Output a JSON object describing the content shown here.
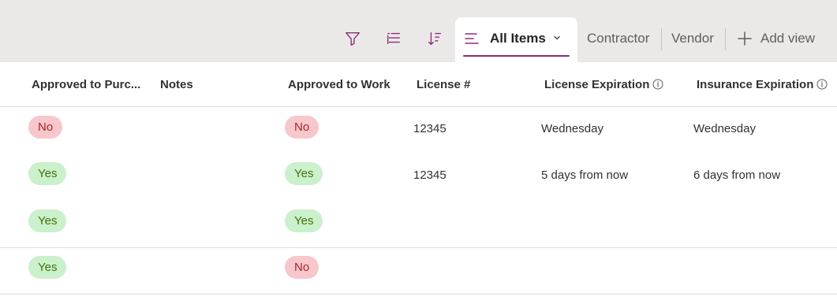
{
  "toolbar": {
    "icons": [
      "filter-icon",
      "group-icon",
      "sort-icon"
    ],
    "active_view": "All Items",
    "views": [
      "Contractor",
      "Vendor"
    ],
    "add_view_label": "Add view"
  },
  "columns": {
    "approved_to_purchase": "Approved to Purc...",
    "notes": "Notes",
    "approved_to_work": "Approved to Work",
    "license_num": "License #",
    "license_expiration": "License Expiration",
    "insurance_expiration": "Insurance Expiration"
  },
  "rows": [
    {
      "approved_to_purchase": "No",
      "notes": "",
      "approved_to_work": "No",
      "license_num": "12345",
      "license_expiration": "Wednesday",
      "insurance_expiration": "Wednesday"
    },
    {
      "approved_to_purchase": "Yes",
      "notes": "",
      "approved_to_work": "Yes",
      "license_num": "12345",
      "license_expiration": "5 days from now",
      "insurance_expiration": "6 days from now"
    },
    {
      "approved_to_purchase": "Yes",
      "notes": "",
      "approved_to_work": "Yes",
      "license_num": "",
      "license_expiration": "",
      "insurance_expiration": ""
    },
    {
      "approved_to_purchase": "Yes",
      "notes": "",
      "approved_to_work": "No",
      "license_num": "",
      "license_expiration": "",
      "insurance_expiration": ""
    }
  ],
  "colors": {
    "accent": "#8b2d7a",
    "no_bg": "#f7c7cb",
    "no_text": "#a4262c",
    "yes_bg": "#caf0cc",
    "yes_text": "#437406"
  }
}
